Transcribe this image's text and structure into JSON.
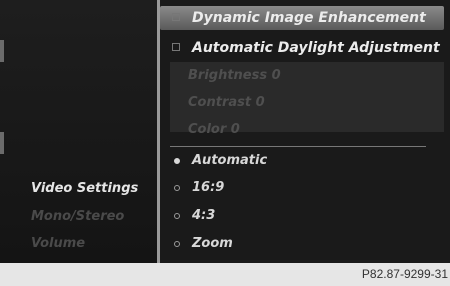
{
  "left_menu": {
    "items": [
      {
        "label": "Video Settings"
      },
      {
        "label": "Mono/Stereo"
      },
      {
        "label": "Volume"
      }
    ]
  },
  "video_menu": {
    "dynamic_image": "Dynamic Image Enhancement",
    "auto_daylight": "Automatic Daylight Adjustment",
    "sub_items": [
      {
        "label": "Brightness 0"
      },
      {
        "label": "Contrast 0"
      },
      {
        "label": "Color 0"
      }
    ],
    "aspect_options": [
      {
        "label": "Automatic",
        "selected": true
      },
      {
        "label": "16:9",
        "selected": false
      },
      {
        "label": "4:3",
        "selected": false
      },
      {
        "label": "Zoom",
        "selected": false
      }
    ]
  },
  "caption": "P82.87-9299-31"
}
